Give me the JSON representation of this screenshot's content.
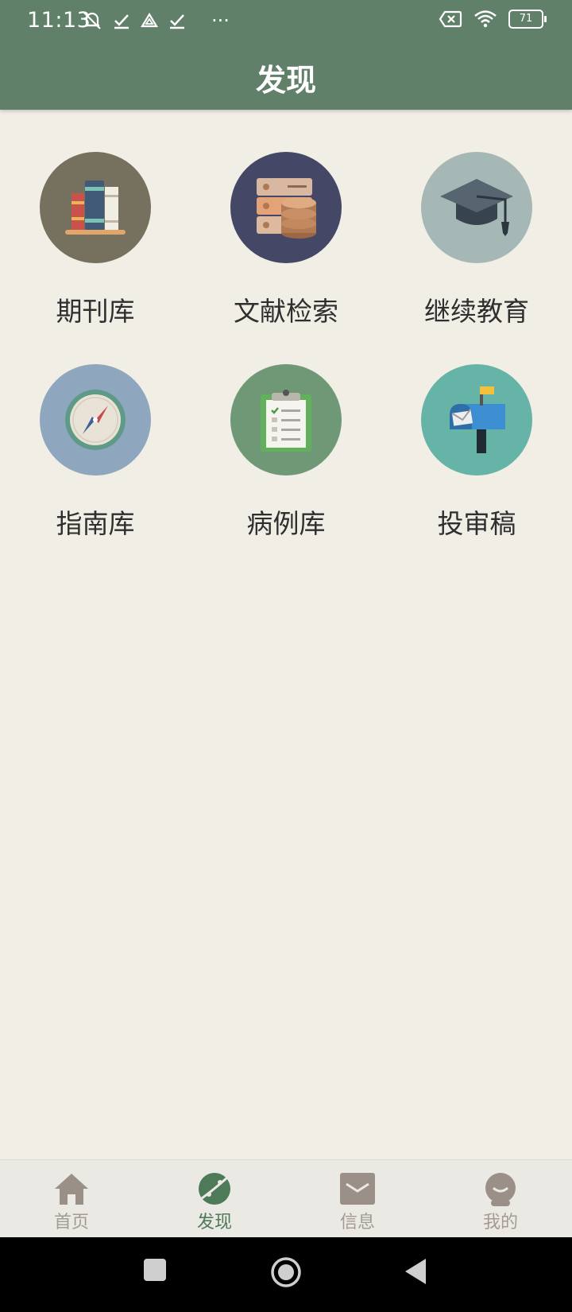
{
  "status_bar": {
    "time": "11:13",
    "more": "···",
    "battery": "71"
  },
  "header": {
    "title": "发现"
  },
  "tiles": [
    {
      "label": "期刊库",
      "icon": "books-icon",
      "color": "#76705f"
    },
    {
      "label": "文献检索",
      "icon": "database-icon",
      "color": "#444866"
    },
    {
      "label": "继续教育",
      "icon": "graduation-cap-icon",
      "color": "#a6b8b6"
    },
    {
      "label": "指南库",
      "icon": "compass-icon",
      "color": "#8fa6bf"
    },
    {
      "label": "病例库",
      "icon": "clipboard-icon",
      "color": "#6e9876"
    },
    {
      "label": "投审稿",
      "icon": "mailbox-icon",
      "color": "#66b4a8"
    }
  ],
  "bottom_nav": {
    "items": [
      {
        "label": "首页",
        "icon": "home-icon"
      },
      {
        "label": "发现",
        "icon": "discover-icon",
        "active": true
      },
      {
        "label": "信息",
        "icon": "message-icon"
      },
      {
        "label": "我的",
        "icon": "profile-icon"
      }
    ]
  },
  "colors": {
    "header": "#60806a",
    "background": "#f1eee6",
    "nav_active": "#4f7a5a",
    "nav_inactive": "#a39b92"
  }
}
